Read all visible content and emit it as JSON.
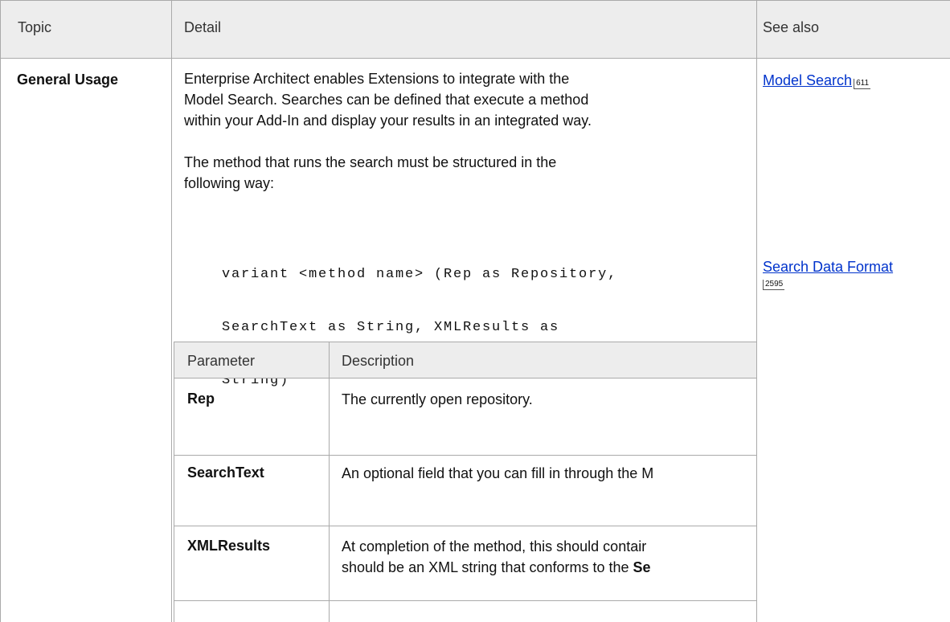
{
  "headers": {
    "topic": "Topic",
    "detail": "Detail",
    "see_also": "See also"
  },
  "row": {
    "topic": "General Usage",
    "detail_para1_line1": "Enterprise Architect enables Extensions to integrate with the",
    "detail_para1_line2": "Model Search. Searches can be defined that execute a method",
    "detail_para1_line3": "within your Add-In and display your results in an integrated way.",
    "detail_para2_line1": "The method that runs the search must be structured in the",
    "detail_para2_line2": "following way:",
    "code_line1": "variant <method name> (Rep as Repository,",
    "code_line2": "SearchText as String, XMLResults as",
    "code_line3": "String)"
  },
  "see_also": {
    "links": [
      {
        "label": "Model Search",
        "page": "611"
      },
      {
        "label": "Search Data Format",
        "page": "2595"
      }
    ]
  },
  "param_table": {
    "headers": {
      "parameter": "Parameter",
      "description": "Description"
    },
    "rows": [
      {
        "name": "Rep",
        "description": "The currently open repository.",
        "description_line2": "",
        "description_line2_bold": ""
      },
      {
        "name": "SearchText",
        "description": "An optional field that you can fill in through the M",
        "description_line2": "",
        "description_line2_bold": ""
      },
      {
        "name": "XMLResults",
        "description": "At completion of the method, this should contair",
        "description_line2": "should be an XML string that conforms to the ",
        "description_line2_bold": "Se"
      }
    ]
  }
}
